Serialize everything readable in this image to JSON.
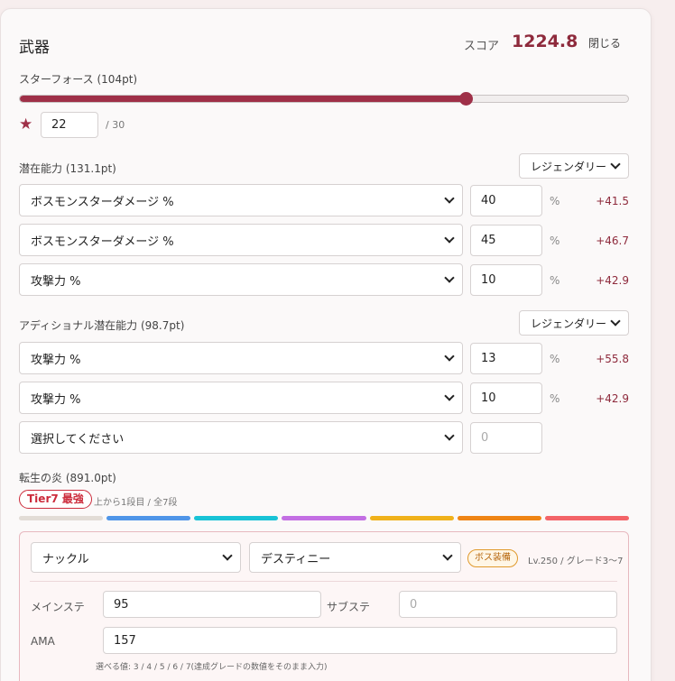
{
  "header": {
    "title": "武器",
    "score_label": "スコア",
    "score_value": "1224.8",
    "close_label": "閉じる"
  },
  "star_force": {
    "label": "スターフォース (104pt)",
    "value": "22",
    "max": "/ 30",
    "level": 0.733
  },
  "potential": {
    "label": "潜在能力 (131.1pt)",
    "grade": "レジェンダリー",
    "lines": [
      {
        "stat": "ボスモンスターダメージ %",
        "value": "40",
        "unit": "%",
        "delta": "+41.5"
      },
      {
        "stat": "ボスモンスターダメージ %",
        "value": "45",
        "unit": "%",
        "delta": "+46.7"
      },
      {
        "stat": "攻撃力 %",
        "value": "10",
        "unit": "%",
        "delta": "+42.9"
      }
    ]
  },
  "additional": {
    "label": "アディショナル潜在能力 (98.7pt)",
    "grade": "レジェンダリー",
    "lines": [
      {
        "stat": "攻撃力 %",
        "value": "13",
        "unit": "%",
        "delta": "+55.8"
      },
      {
        "stat": "攻撃力 %",
        "value": "10",
        "unit": "%",
        "delta": "+42.9"
      },
      {
        "stat": "選択してください",
        "placeholder": "0"
      }
    ]
  },
  "flame": {
    "label": "転生の炎 (891.0pt)",
    "tier_badge": "Tier7 最強",
    "tier_desc": "上から1段目 / 全7段",
    "tier_colors": [
      "#e2dcd6",
      "#4f95e8",
      "#19c3d6",
      "#c36fe3",
      "#f0b21b",
      "#ef8515",
      "#f36468"
    ],
    "weapon_type": "ナックル",
    "weapon_name": "デスティニー",
    "boss_badge": "ボス装備",
    "level_text": "Lv.250 / グレード3〜7",
    "main_stat_label": "メインステ",
    "main_stat_value": "95",
    "sub_stat_label": "サブステ",
    "sub_stat_placeholder": "0",
    "ama_label": "AMA",
    "ama_value": "157",
    "hint": "選べる値: 3 / 4 / 5 / 6 / 7(達成グレードの数値をそのまま入力)"
  }
}
